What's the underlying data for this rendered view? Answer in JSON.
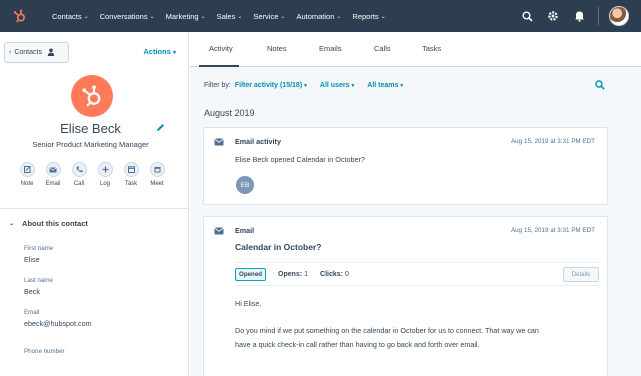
{
  "nav": {
    "items": [
      "Contacts",
      "Conversations",
      "Marketing",
      "Sales",
      "Service",
      "Automation",
      "Reports"
    ],
    "chevron": "⌄",
    "brand_color": "#ff7a59",
    "bar_color": "#2d3e50"
  },
  "sidebar": {
    "back_label": "Contacts",
    "actions_label": "Actions",
    "contact_name": "Elise Beck",
    "contact_title": "Senior Product Marketing Manager",
    "quick_actions": [
      {
        "label": "Note",
        "icon": "note-icon"
      },
      {
        "label": "Email",
        "icon": "email-icon"
      },
      {
        "label": "Call",
        "icon": "call-icon"
      },
      {
        "label": "Log",
        "icon": "log-icon"
      },
      {
        "label": "Task",
        "icon": "task-icon"
      },
      {
        "label": "Meet",
        "icon": "meet-icon"
      }
    ],
    "about_heading": "About this contact",
    "properties": [
      {
        "label": "First name",
        "value": "Elise"
      },
      {
        "label": "Last name",
        "value": "Beck"
      },
      {
        "label": "Email",
        "value": "ebeck@hubspot.com"
      },
      {
        "label": "Phone number",
        "value": ""
      }
    ]
  },
  "main": {
    "tabs": [
      "Activity",
      "Notes",
      "Emails",
      "Calls",
      "Tasks"
    ],
    "active_tab": "Activity",
    "filter": {
      "label": "Filter by:",
      "activity": "Filter activity (15/18)",
      "users": "All users",
      "teams": "All teams"
    },
    "month": "August 2019",
    "activities": [
      {
        "type": "Email activity",
        "date": "Aug 15, 2019 at 3:31 PM EDT",
        "text": "Elise Beck opened Calendar in October?",
        "avatar_initials": "EB"
      },
      {
        "type": "Email",
        "date": "Aug 15, 2019 at 3:31 PM EDT",
        "subject": "Calendar in October?",
        "status": "Opened",
        "opens_label": "Opens:",
        "opens": "1",
        "clicks_label": "Clicks:",
        "clicks": "0",
        "details_label": "Details",
        "greeting": "Hi Elise,",
        "body_line1": "Do you mind if we put something on the calendar in October for us to connect. That way we can",
        "body_line2": "have a quick check-in call rather than having to go back and forth over email."
      }
    ]
  }
}
